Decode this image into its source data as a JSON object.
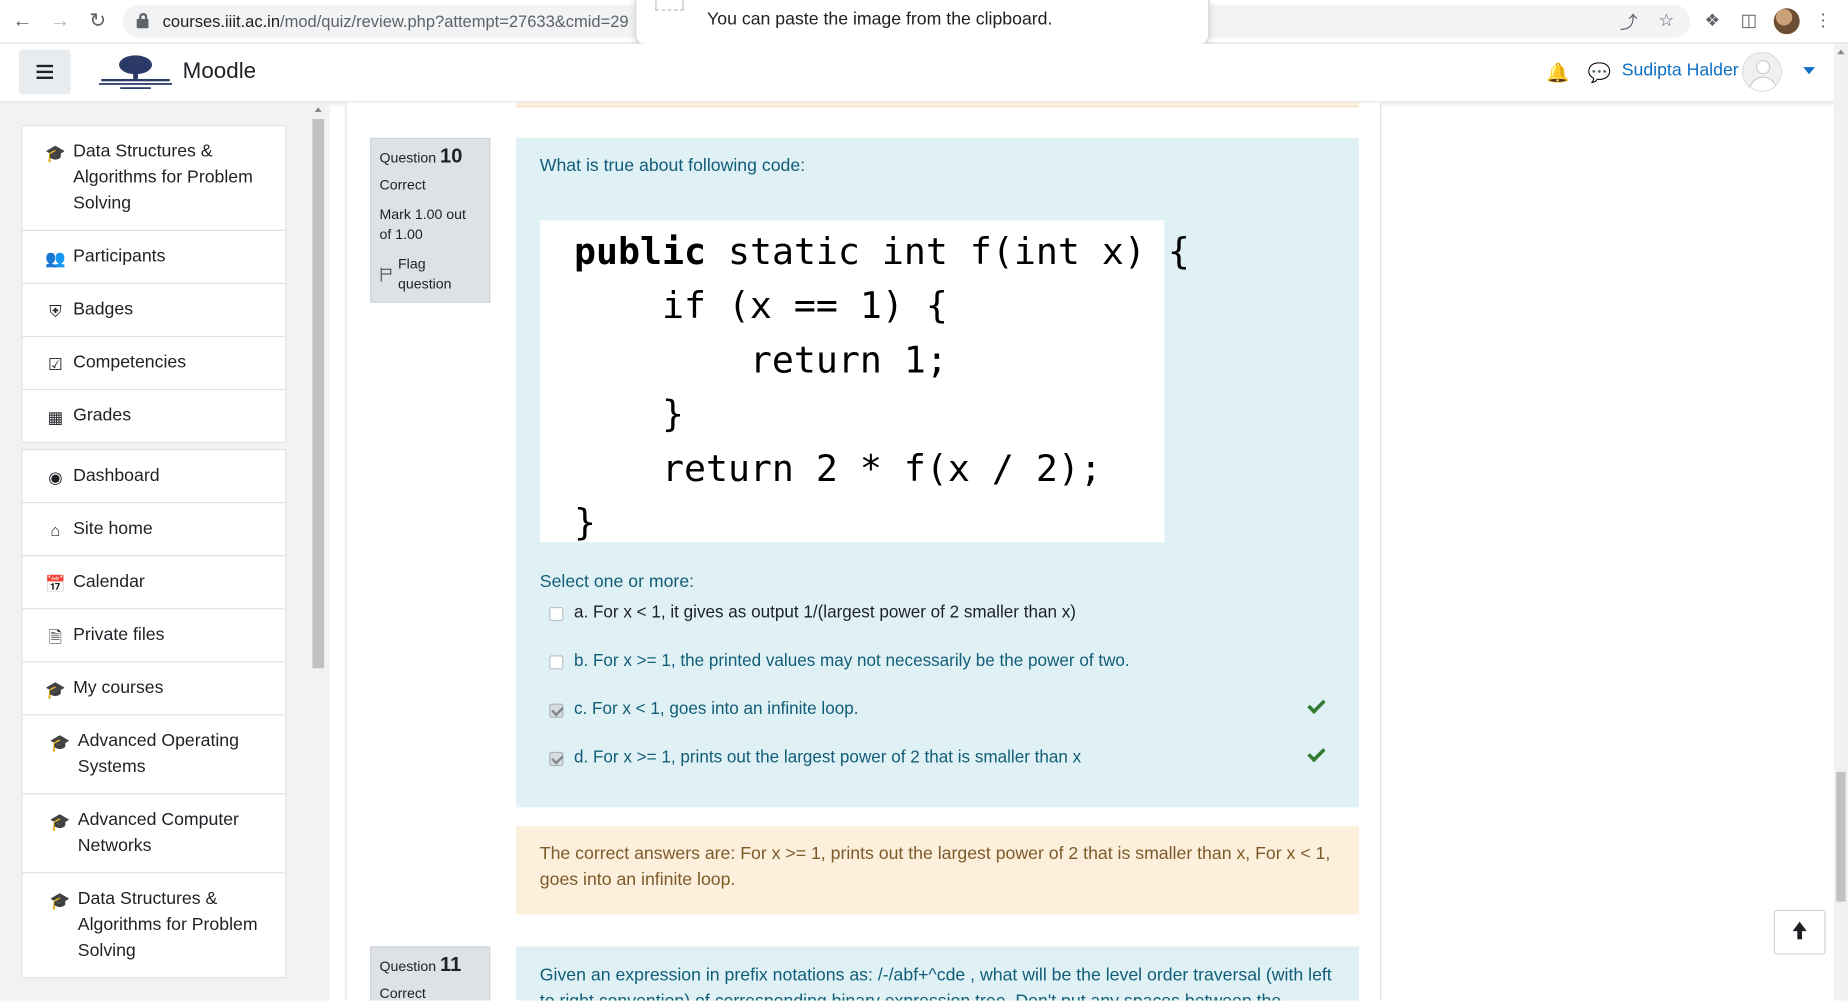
{
  "browser": {
    "url_host": "courses.iiit.ac.in",
    "url_path": "/mod/quiz/review.php?attempt=27633&cmid=29",
    "tooltip_text": "You can paste the image from the clipboard."
  },
  "navbar": {
    "brand": "Moodle",
    "username": "Sudipta Halder"
  },
  "drawer": {
    "group1": [
      {
        "label": "Data Structures & Algorithms for Problem Solving",
        "icon": "graduation-cap-icon"
      },
      {
        "label": "Participants",
        "icon": "users-icon"
      },
      {
        "label": "Badges",
        "icon": "shield-icon"
      },
      {
        "label": "Competencies",
        "icon": "check-square-icon"
      },
      {
        "label": "Grades",
        "icon": "table-icon"
      }
    ],
    "group2": [
      {
        "label": "Dashboard",
        "icon": "tachometer-icon"
      },
      {
        "label": "Site home",
        "icon": "home-icon"
      },
      {
        "label": "Calendar",
        "icon": "calendar-icon"
      },
      {
        "label": "Private files",
        "icon": "file-icon"
      },
      {
        "label": "My courses",
        "icon": "graduation-cap-icon"
      },
      {
        "label": "Advanced Operating Systems",
        "icon": "graduation-cap-icon"
      },
      {
        "label": "Advanced Computer Networks",
        "icon": "graduation-cap-icon"
      },
      {
        "label": "Data Structures & Algorithms for Problem Solving",
        "icon": "graduation-cap-icon"
      }
    ]
  },
  "q10": {
    "label": "Question",
    "number": "10",
    "state": "Correct",
    "grade": "Mark 1.00 out of 1.00",
    "flag": "Flag question",
    "text": "What is true about following code:",
    "code": [
      "public static int f(int x) {",
      "    if (x == 1) {",
      "        return 1;",
      "    }",
      "    return 2 * f(x / 2);",
      "}"
    ],
    "prompt": "Select one or more:",
    "answers": [
      {
        "text": "a. For x < 1, it gives as output 1/(largest power of 2 smaller than x)",
        "checked": false,
        "correct": false
      },
      {
        "text": "b. For x >= 1, the printed values may not necessarily be the power of two.",
        "checked": false,
        "correct": false
      },
      {
        "text": "c. For x < 1, goes into an infinite loop.",
        "checked": true,
        "correct": true
      },
      {
        "text": "d. For x >= 1, prints out the largest power of 2 that is smaller than x",
        "checked": true,
        "correct": true
      }
    ],
    "right_answer": "The correct answers are: For x >= 1, prints out the largest power of 2 that is smaller than x, For x < 1, goes into an infinite loop."
  },
  "q11": {
    "label": "Question",
    "number": "11",
    "state": "Correct",
    "text": "Given an expression in prefix notations as:  /-/abf+^cde , what will be the level order traversal (with left to right convention) of corresponding binary expression tree. Don't put any spaces between the"
  },
  "colors": {
    "formulation_bg": "#e0f1f6",
    "formulation_text": "#115d77",
    "outcome_bg": "#fcefdc",
    "outcome_text": "#7d5a29",
    "link": "#0f6fc5",
    "correct_tick": "#357a32"
  }
}
